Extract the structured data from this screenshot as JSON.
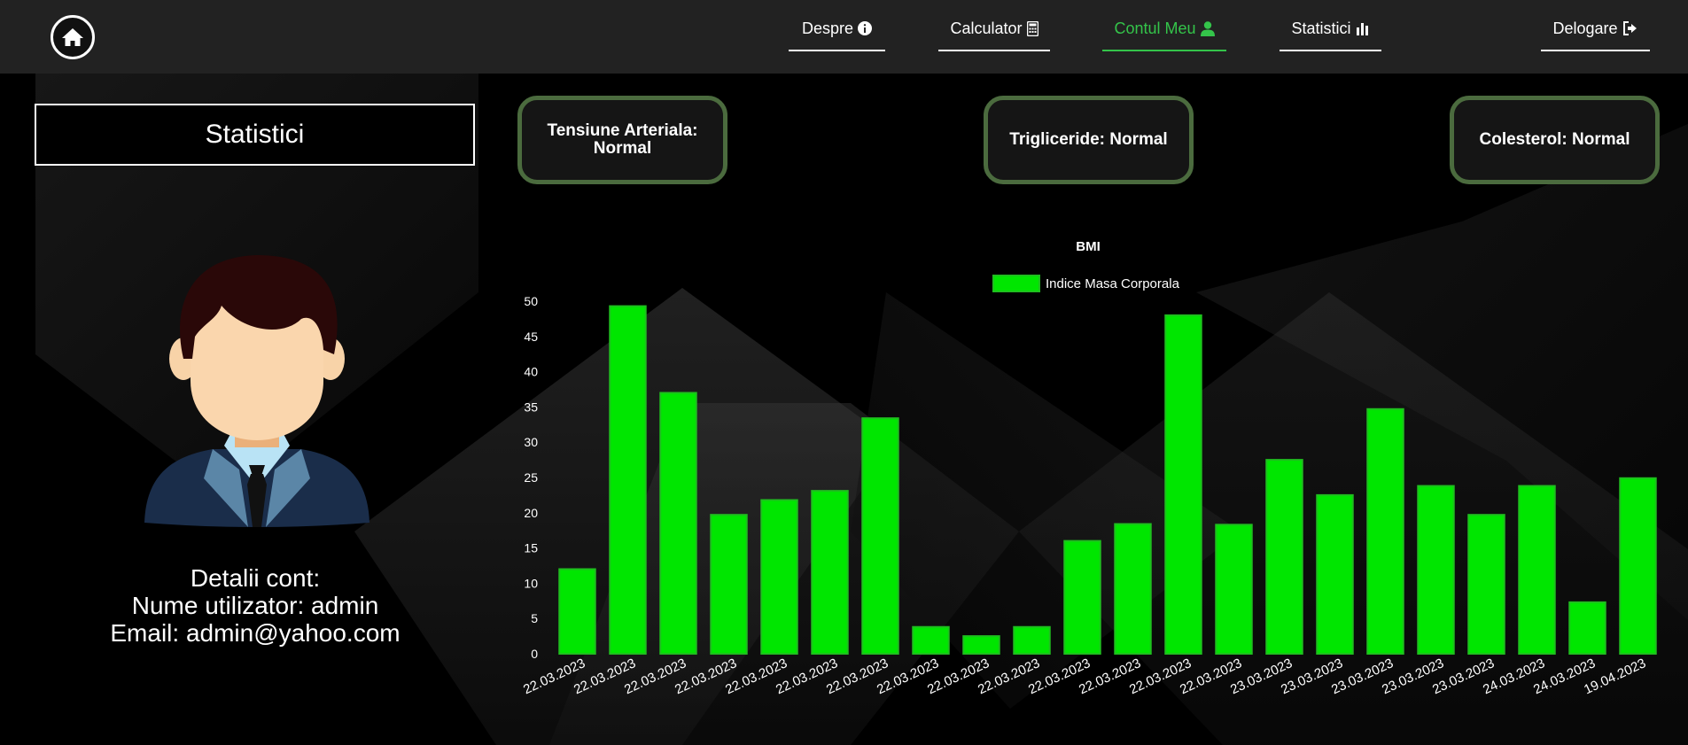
{
  "nav": {
    "items": [
      {
        "label": "Despre",
        "icon": "info-circle-icon"
      },
      {
        "label": "Calculator",
        "icon": "calculator-icon"
      },
      {
        "label": "Contul Meu",
        "icon": "user-icon",
        "active": true
      },
      {
        "label": "Statistici",
        "icon": "bar-chart-icon"
      },
      {
        "label": "Delogare",
        "icon": "sign-out-icon"
      }
    ],
    "active_color": "#34c44a"
  },
  "sidebar": {
    "title": "Statistici",
    "details_heading": "Detalii cont:",
    "username_line": "Nume utilizator: admin",
    "email_line": "Email: admin@yahoo.com"
  },
  "cards": [
    {
      "label": "Tensiune Arteriala: Normal"
    },
    {
      "label": "Trigliceride: Normal"
    },
    {
      "label": "Colesterol: Normal"
    }
  ],
  "chart_data": {
    "type": "bar",
    "title": "BMI",
    "series": [
      {
        "name": "Indice Masa Corporala",
        "color": "#00e600",
        "values": [
          12,
          49.3,
          37,
          19.7,
          21.8,
          23.1,
          33.4,
          3.8,
          2.5,
          3.8,
          16,
          18.4,
          48,
          18.3,
          27.5,
          22.5,
          34.7,
          23.8,
          19.7,
          23.8,
          7.3,
          24.9
        ]
      }
    ],
    "categories": [
      "22.03.2023",
      "22.03.2023",
      "22.03.2023",
      "22.03.2023",
      "22.03.2023",
      "22.03.2023",
      "22.03.2023",
      "22.03.2023",
      "22.03.2023",
      "22.03.2023",
      "22.03.2023",
      "22.03.2023",
      "22.03.2023",
      "22.03.2023",
      "23.03.2023",
      "23.03.2023",
      "23.03.2023",
      "23.03.2023",
      "23.03.2023",
      "24.03.2023",
      "24.03.2023",
      "19.04.2023"
    ],
    "ylim": [
      0,
      50
    ],
    "yticks": [
      0,
      5,
      10,
      15,
      20,
      25,
      30,
      35,
      40,
      45,
      50
    ],
    "legend": "top-center",
    "grid": false
  }
}
